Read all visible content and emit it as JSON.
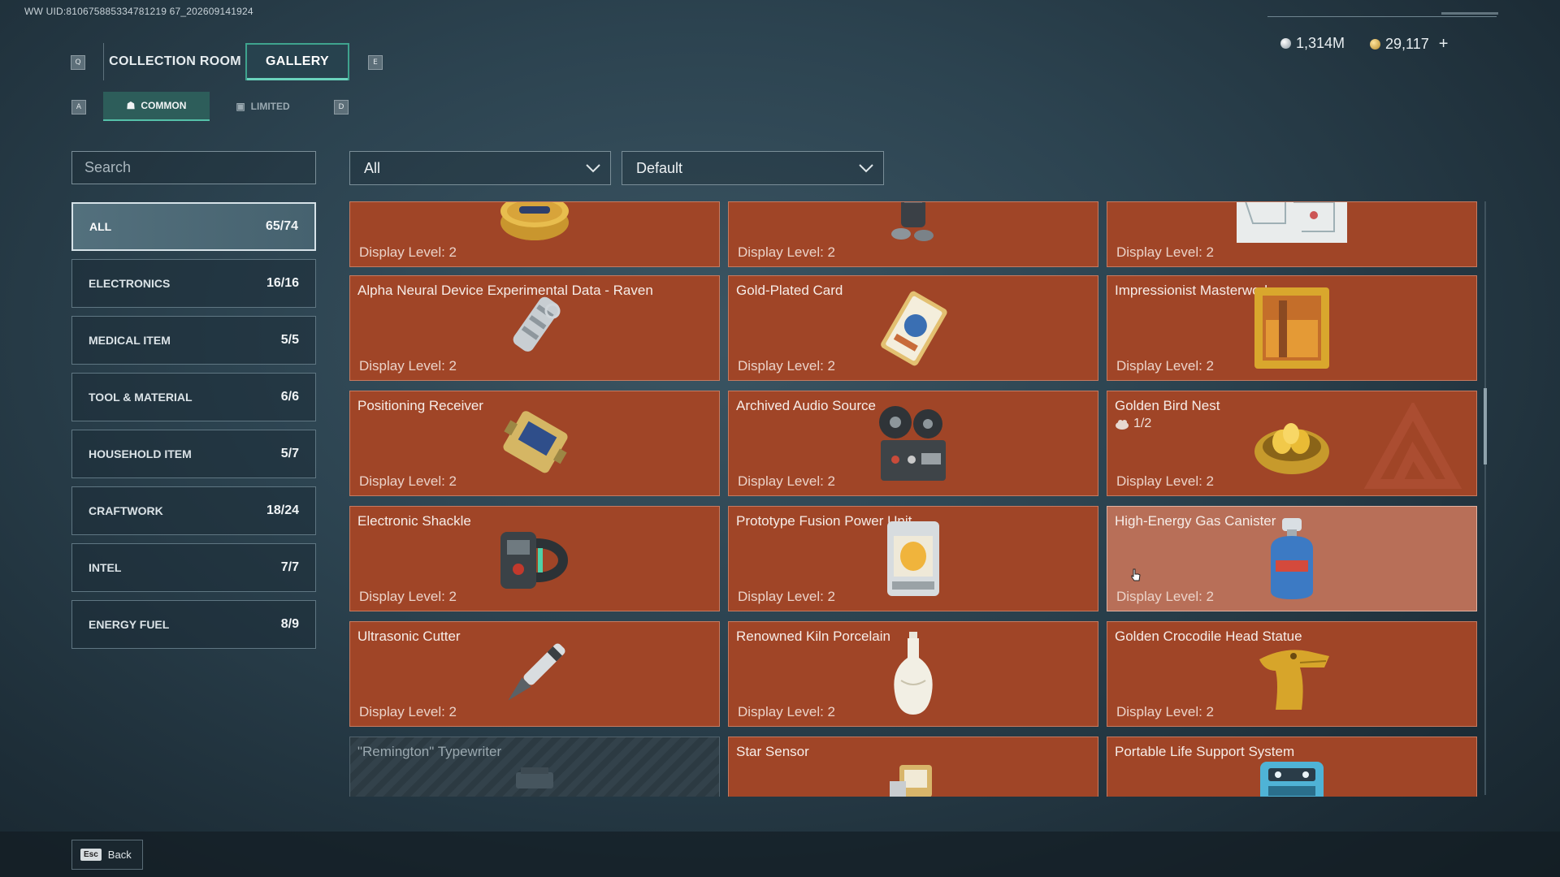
{
  "uid": "WW UID:810675885334781219 67_202609141924",
  "currency": {
    "silver": "1,314M",
    "gold": "29,117",
    "add": "+"
  },
  "keys": {
    "prev_tab": "Q",
    "next_tab": "E",
    "prev_sub": "A",
    "next_sub": "D",
    "back": "Esc"
  },
  "tabs": {
    "collection": "COLLECTION ROOM",
    "gallery": "GALLERY",
    "active": "GALLERY"
  },
  "subtabs": {
    "common": "COMMON",
    "limited": "LIMITED",
    "active": "COMMON"
  },
  "search": {
    "placeholder": "Search"
  },
  "filters": {
    "type": "All",
    "sort": "Default"
  },
  "categories": [
    {
      "label": "ALL",
      "count": "65/74",
      "active": true
    },
    {
      "label": "ELECTRONICS",
      "count": "16/16"
    },
    {
      "label": "MEDICAL ITEM",
      "count": "5/5"
    },
    {
      "label": "TOOL & MATERIAL",
      "count": "6/6"
    },
    {
      "label": "HOUSEHOLD ITEM",
      "count": "5/7"
    },
    {
      "label": "CRAFTWORK",
      "count": "18/24"
    },
    {
      "label": "INTEL",
      "count": "7/7"
    },
    {
      "label": "ENERGY FUEL",
      "count": "8/9"
    }
  ],
  "items": [
    {
      "name": "",
      "level": "Display Level: 2",
      "icon": "caviar-tin-icon"
    },
    {
      "name": "",
      "level": "Display Level: 2",
      "icon": "diving-gear-icon"
    },
    {
      "name": "",
      "level": "Display Level: 2",
      "icon": "map-document-icon"
    },
    {
      "name": "Alpha Neural Device Experimental Data - Raven",
      "level": "Display Level: 2",
      "icon": "data-canister-icon"
    },
    {
      "name": "Gold-Plated Card",
      "level": "Display Level: 2",
      "icon": "gold-card-icon"
    },
    {
      "name": "Impressionist Masterwork",
      "level": "Display Level: 2",
      "icon": "framed-painting-icon"
    },
    {
      "name": "Positioning Receiver",
      "level": "Display Level: 2",
      "icon": "receiver-device-icon"
    },
    {
      "name": "Archived Audio Source",
      "level": "Display Level: 2",
      "icon": "reel-recorder-icon"
    },
    {
      "name": "Golden Bird Nest",
      "level": "Display Level: 2",
      "icon": "golden-nest-icon",
      "stack": "1/2"
    },
    {
      "name": "Electronic Shackle",
      "level": "Display Level: 2",
      "icon": "shackle-device-icon"
    },
    {
      "name": "Prototype Fusion Power Unit",
      "level": "Display Level: 2",
      "icon": "fusion-unit-icon"
    },
    {
      "name": "High-Energy Gas Canister",
      "level": "Display Level: 2",
      "icon": "gas-canister-icon",
      "hover": true
    },
    {
      "name": "Ultrasonic Cutter",
      "level": "Display Level: 2",
      "icon": "cutter-pen-icon"
    },
    {
      "name": "Renowned Kiln Porcelain",
      "level": "Display Level: 2",
      "icon": "porcelain-vase-icon"
    },
    {
      "name": "Golden Crocodile Head Statue",
      "level": "Display Level: 2",
      "icon": "crocodile-statue-icon"
    },
    {
      "name": "\"Remington\" Typewriter",
      "level": "",
      "icon": "typewriter-icon",
      "locked": true
    },
    {
      "name": "Star Sensor",
      "level": "",
      "icon": "star-sensor-icon"
    },
    {
      "name": "Portable Life Support System",
      "level": "",
      "icon": "life-support-icon"
    }
  ],
  "footer": {
    "back_label": "Back"
  },
  "colors": {
    "card": "#a04527",
    "card_hover": "#b86f58",
    "accent": "#3fa38e"
  }
}
